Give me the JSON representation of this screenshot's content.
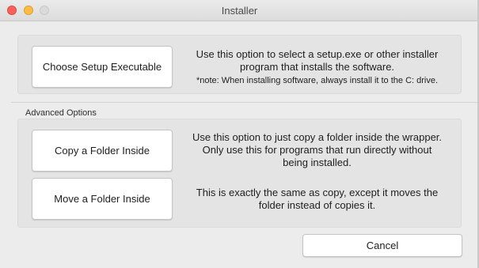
{
  "window": {
    "title": "Installer"
  },
  "main": {
    "choose_button": "Choose Setup Executable",
    "choose_desc_line1": "Use this option to select a setup.exe or other installer",
    "choose_desc_line2": "program that installs the software.",
    "choose_note": "*note: When installing software, always install it to the C: drive."
  },
  "advanced": {
    "label": "Advanced Options",
    "copy_button": "Copy a Folder Inside",
    "copy_desc_line1": "Use this option to just copy a folder inside the wrapper.",
    "copy_desc_line2": "Only use this for programs that run directly without",
    "copy_desc_line3": "being installed.",
    "move_button": "Move a Folder Inside",
    "move_desc_line1": "This is exactly the same as copy, except it moves the",
    "move_desc_line2": "folder instead of copies it."
  },
  "footer": {
    "cancel_button": "Cancel"
  },
  "colors": {
    "close": "#fc605b",
    "minimize": "#fdbc40",
    "maximize_disabled": "#dadada",
    "panel_bg": "#e4e4e4",
    "window_bg": "#ececec"
  }
}
